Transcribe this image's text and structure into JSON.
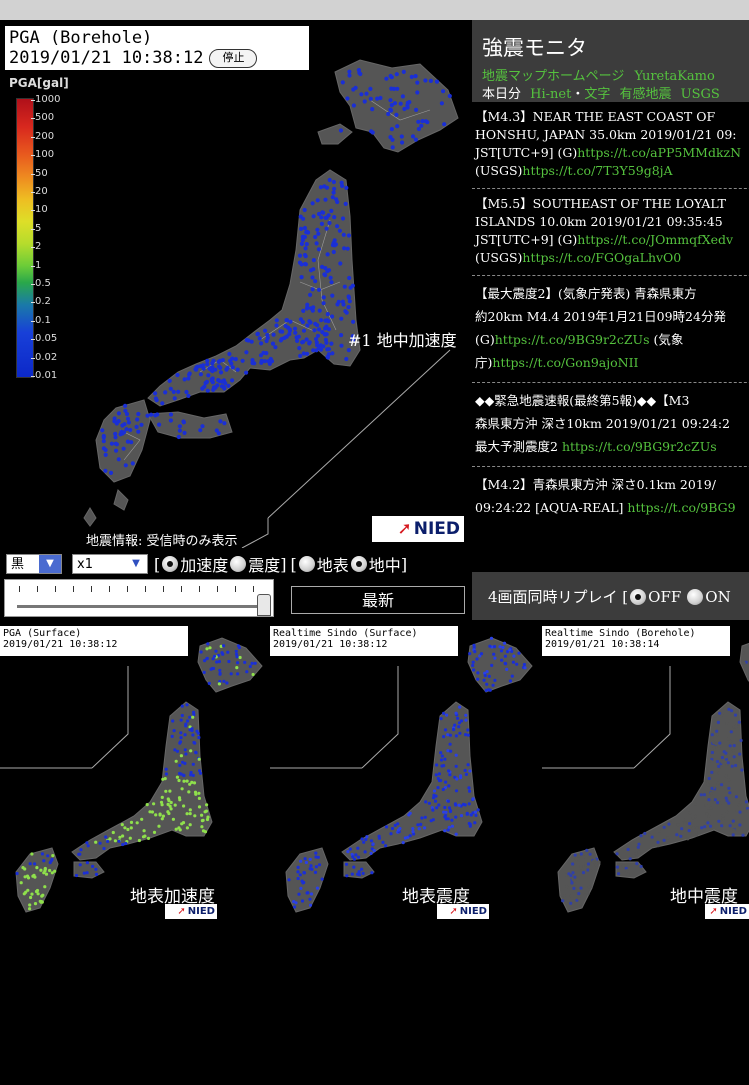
{
  "main": {
    "title": "PGA (Borehole)",
    "timestamp": "2019/01/21 10:38:12",
    "stop_button": "停止",
    "legend_title": "PGA[gal]",
    "legend_ticks": [
      "1000",
      "500",
      "200",
      "100",
      "50",
      "20",
      "10",
      "5",
      "2",
      "1",
      "0.5",
      "0.2",
      "0.1",
      "0.05",
      "0.02",
      "0.01"
    ],
    "label_1": "#1 地中加速度",
    "footnote": "地震情報: 受信時のみ表示",
    "nied_logo": "NIED"
  },
  "controls": {
    "color_select": "黒",
    "speed_select": "x1",
    "bracket_open": "[",
    "bracket_close": "]",
    "radio_accel": "加速度",
    "radio_intensity": "震度",
    "radio_surface": "地表",
    "radio_borehole": "地中",
    "latest_button": "最新"
  },
  "panel": {
    "title": "強震モニタ",
    "link_eqmap": "地震マップホームページ",
    "link_yureta": "YuretaKamo",
    "honjitsu": "本日分",
    "link_hinet": "Hi-net",
    "dot": "・",
    "link_moji": "文字",
    "link_yukan": "有感地震",
    "link_usgs": "USGS",
    "feed": [
      {
        "lines": [
          "【M4.3】NEAR THE EAST COAST OF",
          "HONSHU, JAPAN 35.0km 2019/01/21 09:"
        ],
        "line3_text": "JST[UTC+9] (G)",
        "line3_link": "https://t.co/aPP5MMdkzN",
        "line4_text": "(USGS)",
        "line4_link": "https://t.co/7T3Y59g8jA"
      },
      {
        "lines": [
          "【M5.5】SOUTHEAST OF THE LOYALT",
          "ISLANDS 10.0km 2019/01/21 09:35:45"
        ],
        "line3_text": "JST[UTC+9] (G)",
        "line3_link": "https://t.co/JOmmqfXedv",
        "line4_text": "(USGS)",
        "line4_link": "https://t.co/FGOgaLhvO0"
      },
      {
        "lines": [
          "【最大震度2】(気象庁発表) 青森県東方",
          "約20km M4.4 2019年1月21日09時24分発"
        ],
        "line3_text": "(G)",
        "line3_link": "https://t.co/9BG9r2cZUs",
        "line3_after": " (気象",
        "line4_text": "庁)",
        "line4_link": "https://t.co/Gon9ajoNII"
      },
      {
        "lines": [
          "◆◆緊急地震速報(最終第5報)◆◆【M3",
          "森県東方沖 深さ10km 2019/01/21 09:24:2"
        ],
        "line3_text": "最大予測震度2 ",
        "line3_link": "https://t.co/9BG9r2cZUs"
      },
      {
        "lines": [
          "【M4.2】青森県東方沖 深さ0.1km 2019/"
        ],
        "line3_text": "09:24:22 [AQUA-REAL] ",
        "line3_link": "https://t.co/9BG9"
      }
    ],
    "replay_label": "4画面同時リプレイ [",
    "replay_off": "OFF",
    "replay_on": "ON"
  },
  "small_maps": [
    {
      "title": "PGA (Surface)",
      "timestamp": "2019/01/21 10:38:12",
      "caption": "地表加速度",
      "logo": "NIED"
    },
    {
      "title": "Realtime Sindo (Surface)",
      "timestamp": "2019/01/21 10:38:12",
      "caption": "地表震度",
      "logo": "NIED"
    },
    {
      "title": "Realtime Sindo (Borehole)",
      "timestamp": "2019/01/21 10:38:14",
      "caption": "地中震度",
      "logo": "NIED"
    }
  ],
  "colors": {
    "background": "#000000",
    "land": "#555555",
    "panel_bg": "#3c3c3c",
    "link_green": "#55c23e",
    "station_blue": "#1a2fd6",
    "station_green": "#8fe04c",
    "nied_navy": "#0b1e6b",
    "nied_red": "#d6181e"
  }
}
